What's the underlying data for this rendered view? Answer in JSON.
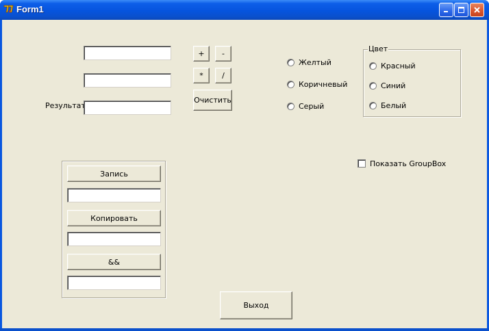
{
  "window": {
    "title": "Form1",
    "icon": "delphi-app-icon",
    "controls": [
      "minimize-icon",
      "maximize-icon",
      "close-icon"
    ]
  },
  "calculator": {
    "operand1": "",
    "operand2": "",
    "result_label": "Результат",
    "result_value": "",
    "buttons": {
      "plus": "+",
      "minus": "-",
      "multiply": "*",
      "divide": "/",
      "clear": "Очистить"
    }
  },
  "radio_group_standalone": {
    "options": [
      "Желтый",
      "Коричневый",
      "Серый"
    ]
  },
  "color_group": {
    "caption": "Цвет",
    "options": [
      "Красный",
      "Синий",
      "Белый"
    ]
  },
  "show_groupbox_checkbox": {
    "label": "Показать GroupBox",
    "checked": false
  },
  "panel": {
    "write_button": "Запись",
    "edit1": "",
    "copy_button": "Копировать",
    "edit2": "",
    "and_button": "&&",
    "edit3": ""
  },
  "exit_button": "Выход",
  "colors": {
    "title_bar": "#0654de",
    "client_bg": "#ece9d8",
    "close_button": "#d9532b"
  }
}
